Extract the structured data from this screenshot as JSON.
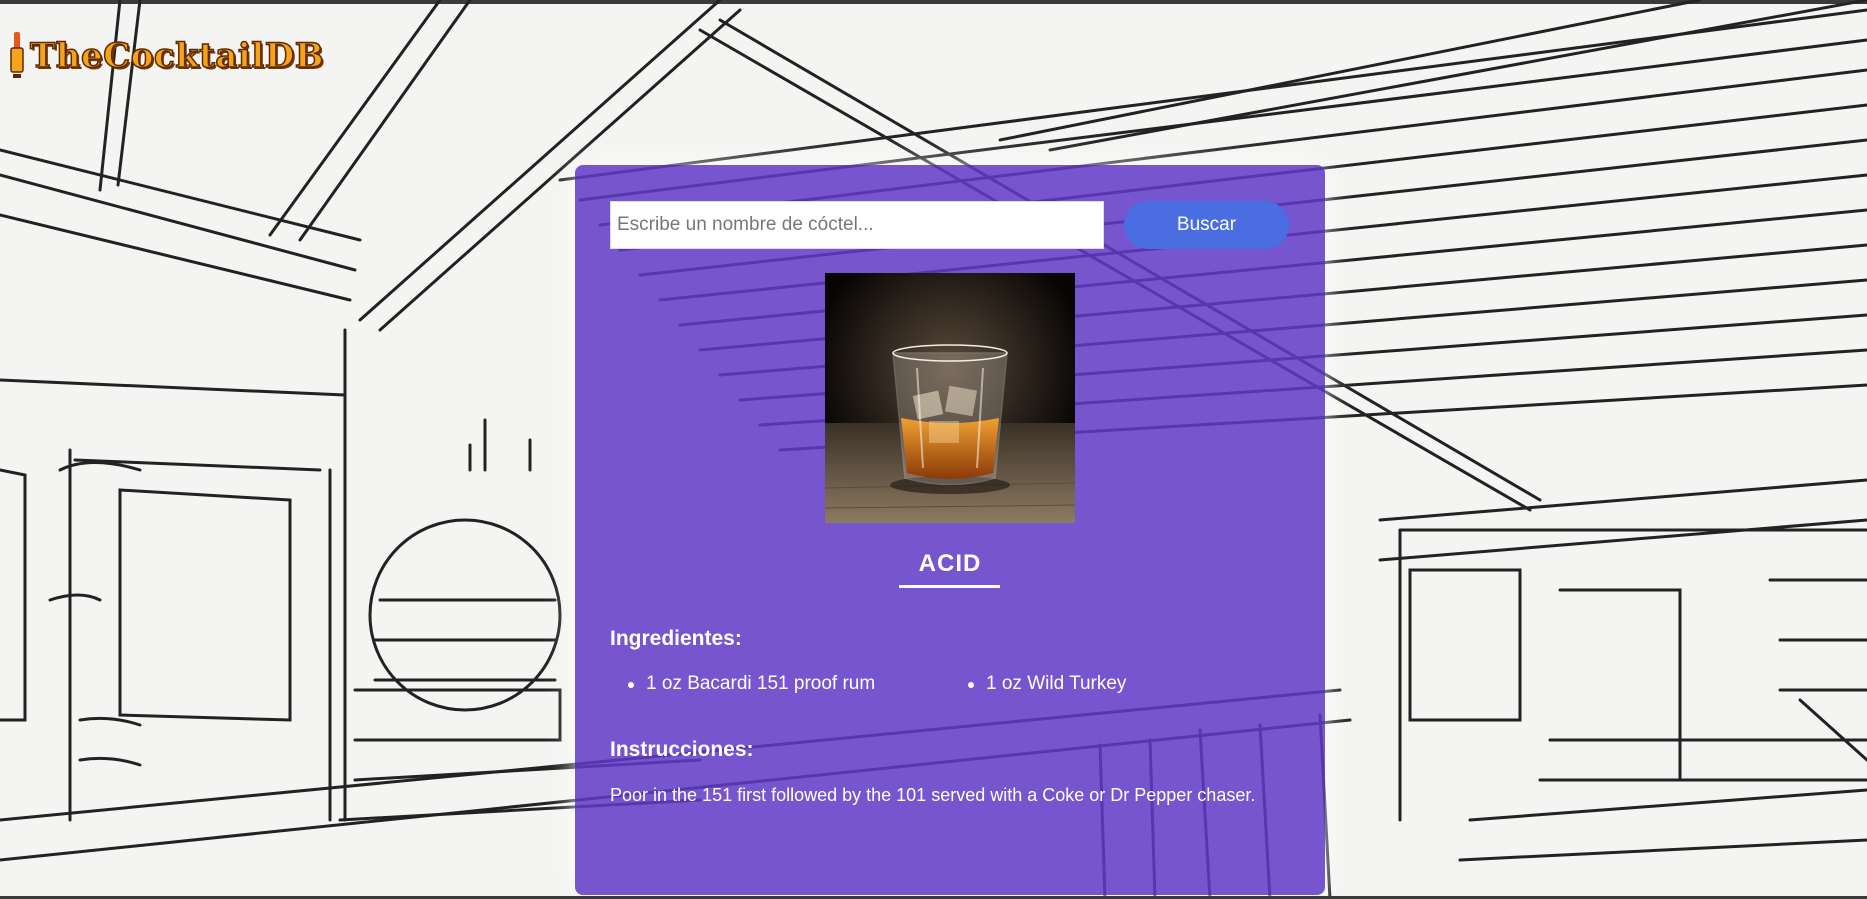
{
  "brand": {
    "logo_text": "TheCocktailDB"
  },
  "search": {
    "placeholder": "Escribe un nombre de cóctel...",
    "value": "",
    "button_label": "Buscar"
  },
  "drink": {
    "name": "ACID",
    "ingredients_heading": "Ingredientes:",
    "ingredients": [
      "1 oz Bacardi 151 proof rum",
      "1 oz Wild Turkey"
    ],
    "instructions_heading": "Instrucciones:",
    "instructions": "Poor in the 151 first followed by the 101 served with a Coke or Dr Pepper chaser."
  },
  "colors": {
    "panel": "#623ac8",
    "button": "#4a6ee2",
    "logo_fill": "#f6a21a",
    "logo_outline": "#5a2a05"
  }
}
